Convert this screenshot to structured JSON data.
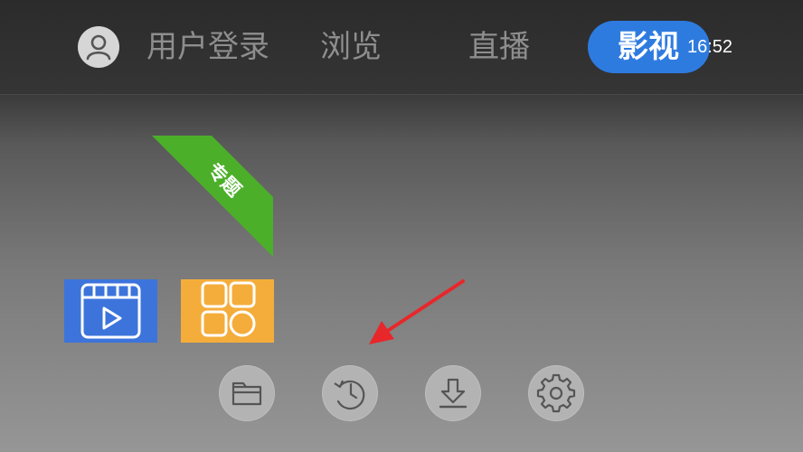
{
  "header": {
    "user_login": "用户登录",
    "browse": "浏览",
    "live": "直播",
    "movies": "影视",
    "clock": "16:52"
  },
  "ribbon": {
    "label": "专题",
    "color": "#4caf2a"
  },
  "tiles": [
    {
      "icon": "video-icon",
      "color": "#3d74db"
    },
    {
      "icon": "apps-grid-icon",
      "color": "#f4ad3b"
    }
  ],
  "bottom_buttons": [
    {
      "icon": "folder-icon"
    },
    {
      "icon": "history-icon"
    },
    {
      "icon": "download-icon"
    },
    {
      "icon": "settings-gear-icon"
    }
  ],
  "colors": {
    "accent": "#2e7be0",
    "annotation_arrow": "#e8272a"
  }
}
